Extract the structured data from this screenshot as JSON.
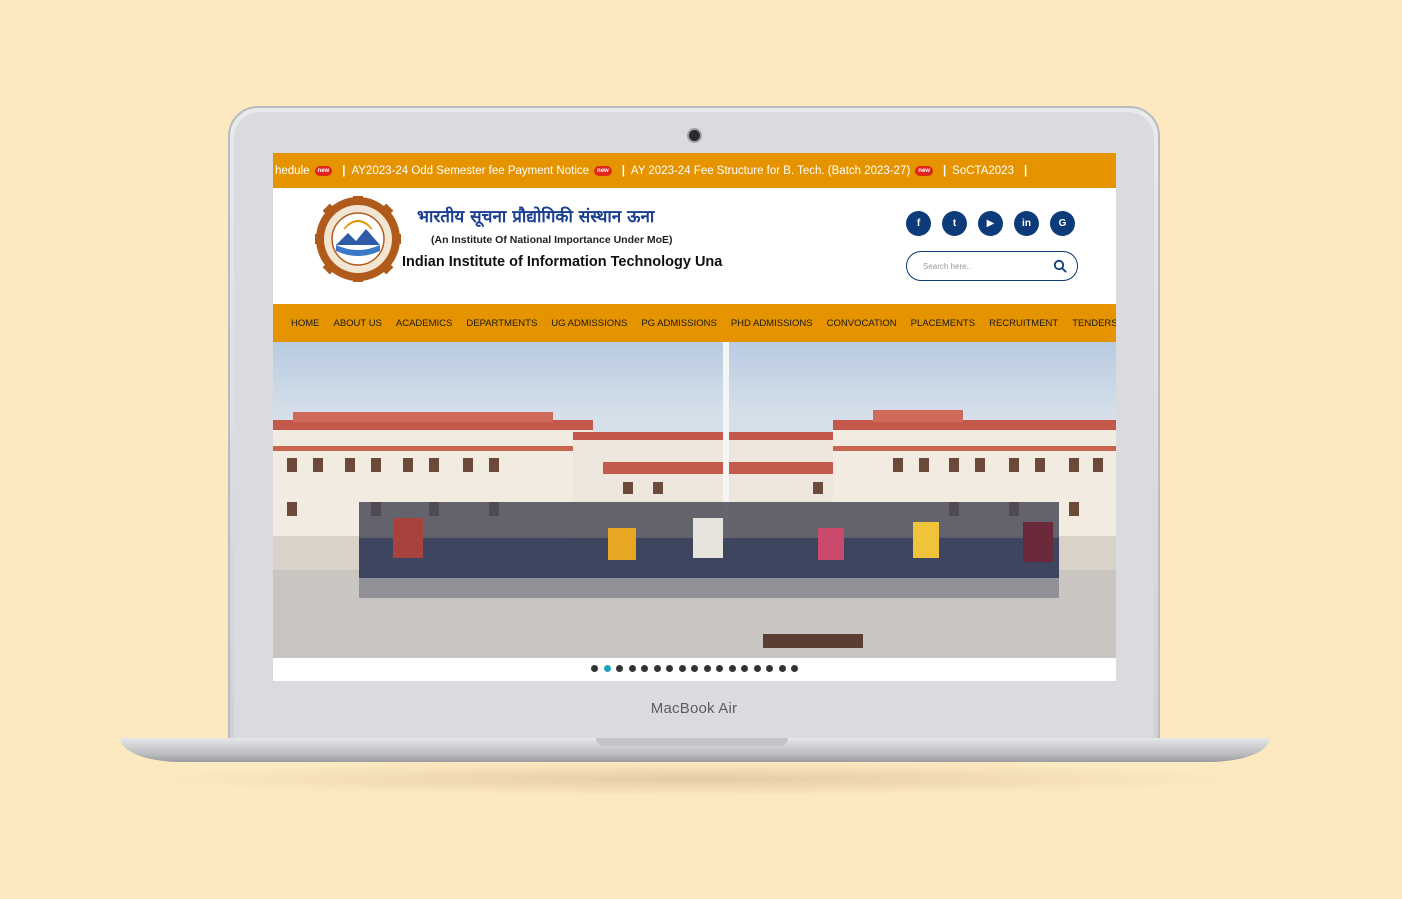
{
  "device": {
    "brand_label": "MacBook Air"
  },
  "ticker": {
    "items": [
      {
        "text": "hedule",
        "badge": "new"
      },
      {
        "text": "AY2023-24 Odd Semester fee Payment Notice",
        "badge": "new"
      },
      {
        "text": "AY 2023-24 Fee Structure for B. Tech. (Batch 2023-27)",
        "badge": "new"
      },
      {
        "text": "SoCTA2023",
        "badge": ""
      }
    ],
    "separator": "|"
  },
  "header": {
    "title_hindi": "भारतीय सूचना प्रौद्योगिकी संस्थान ऊना",
    "subtitle": "(An Institute Of National Importance Under MoE)",
    "title_english": "Indian Institute of Information Technology Una",
    "social": [
      {
        "name": "facebook-icon",
        "glyph": "f"
      },
      {
        "name": "twitter-icon",
        "glyph": "t"
      },
      {
        "name": "youtube-icon",
        "glyph": "▶"
      },
      {
        "name": "linkedin-icon",
        "glyph": "in"
      },
      {
        "name": "google-icon",
        "glyph": "G"
      }
    ],
    "search_placeholder": "Search here.."
  },
  "nav": {
    "items": [
      "HOME",
      "ABOUT US",
      "ACADEMICS",
      "DEPARTMENTS",
      "UG ADMISSIONS",
      "PG ADMISSIONS",
      "PHD ADMISSIONS",
      "CONVOCATION",
      "PLACEMENTS",
      "RECRUITMENT",
      "TENDERS"
    ]
  },
  "slider": {
    "slide_count": 17,
    "active_index": 1
  },
  "colors": {
    "accent": "#e59400",
    "navy": "#0d3b7a",
    "background": "#fde9c0",
    "dot_active": "#19a3b8"
  }
}
